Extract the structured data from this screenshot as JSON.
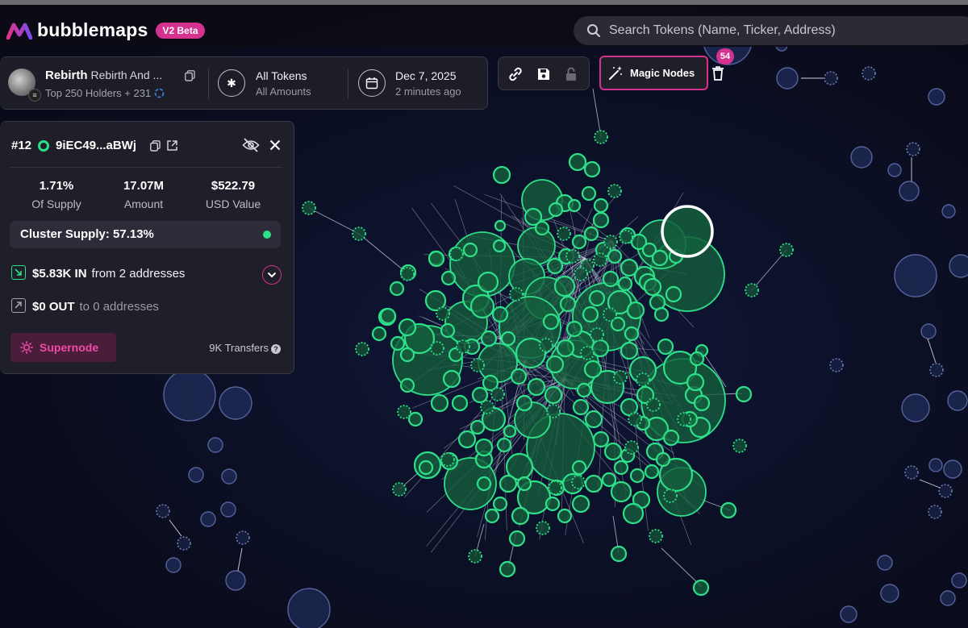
{
  "app": {
    "name": "bubblemaps",
    "badge": "V2 Beta"
  },
  "search": {
    "placeholder": "Search Tokens (Name, Ticker, Address)"
  },
  "token": {
    "symbol": "Rebirth",
    "name": "Rebirth And ...",
    "holders": "Top 250 Holders + 231"
  },
  "filters": {
    "tokens_title": "All Tokens",
    "tokens_sub": "All Amounts",
    "date_title": "Dec 7, 2025",
    "date_sub": "2 minutes ago"
  },
  "toolbar": {
    "magic_nodes_label": "Magic Nodes",
    "magic_nodes_count": "54"
  },
  "holder_panel": {
    "rank": "#12",
    "address": "9iEC49...aBWj",
    "stats": [
      {
        "value": "1.71%",
        "label": "Of Supply"
      },
      {
        "value": "17.07M",
        "label": "Amount"
      },
      {
        "value": "$522.79",
        "label": "USD Value"
      }
    ],
    "cluster_supply": "Cluster Supply: 57.13%",
    "in_amount": "$5.83K IN",
    "in_from": "from 2 addresses",
    "out_amount": "$0 OUT",
    "out_to": "to 0 addresses",
    "supernode_label": "Supernode",
    "transfers": "9K Transfers"
  },
  "colors": {
    "accent_pink": "#d5318f",
    "cluster_green": "#2ee08a",
    "node_blue": "#3a4a80",
    "background": "#0b0c1c"
  }
}
